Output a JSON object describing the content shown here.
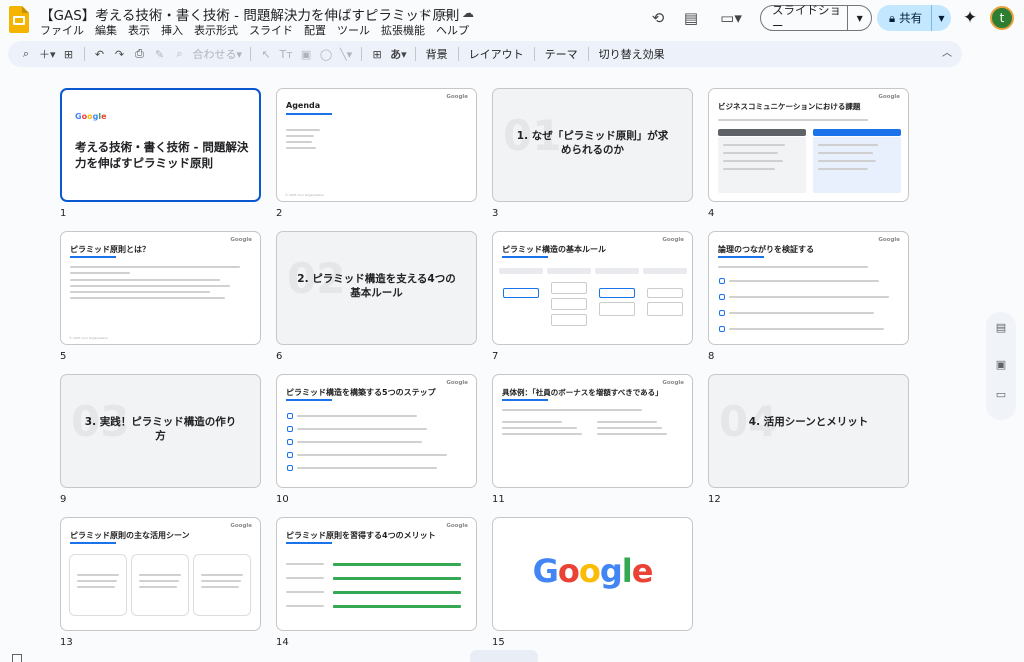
{
  "app": {
    "doc_title": "【GAS】考える技術・書く技術 - 問題解決力を伸ばすピラミッド原則",
    "menu": [
      "ファイル",
      "編集",
      "表示",
      "挿入",
      "表示形式",
      "スライド",
      "配置",
      "ツール",
      "拡張機能",
      "ヘルプ"
    ],
    "slideshow_label": "スライドショー",
    "share_label": "共有",
    "avatar_letter": "t"
  },
  "toolbar": {
    "zoom_label": "合わせる",
    "text_style": "あ",
    "background": "背景",
    "layout": "レイアウト",
    "theme": "テーマ",
    "transition": "切り替え効果"
  },
  "slides": [
    {
      "number": "1",
      "title": "考える技術・書く技術 - 問題解決力を伸ばすピラミッド原則",
      "logo": "Google"
    },
    {
      "number": "2",
      "title": "Agenda",
      "logo": "Google"
    },
    {
      "number": "3",
      "section": "01",
      "title": "1. なぜ「ピラミッド原則」が求められるのか"
    },
    {
      "number": "4",
      "title": "ビジネスコミュニケーションにおける課題",
      "logo": "Google"
    },
    {
      "number": "5",
      "title": "ピラミッド原則とは？",
      "logo": "Google"
    },
    {
      "number": "6",
      "section": "02",
      "title": "2. ピラミッド構造を支える4つの基本ルール"
    },
    {
      "number": "7",
      "title": "ピラミッド構造の基本ルール",
      "logo": "Google"
    },
    {
      "number": "8",
      "title": "論理のつながりを検証する",
      "logo": "Google"
    },
    {
      "number": "9",
      "section": "03",
      "title": "3. 実践！ピラミッド構造の作り方"
    },
    {
      "number": "10",
      "title": "ピラミッド構造を構築する5つのステップ",
      "logo": "Google"
    },
    {
      "number": "11",
      "title": "具体例：「社員のボーナスを増額すべきである」",
      "logo": "Google"
    },
    {
      "number": "12",
      "section": "04",
      "title": "4. 活用シーンとメリット"
    },
    {
      "number": "13",
      "title": "ピラミッド原則の主な活用シーン",
      "logo": "Google"
    },
    {
      "number": "14",
      "title": "ピラミッド原則を習得する4つのメリット",
      "logo": "Google"
    },
    {
      "number": "15",
      "logo": "Google"
    }
  ]
}
